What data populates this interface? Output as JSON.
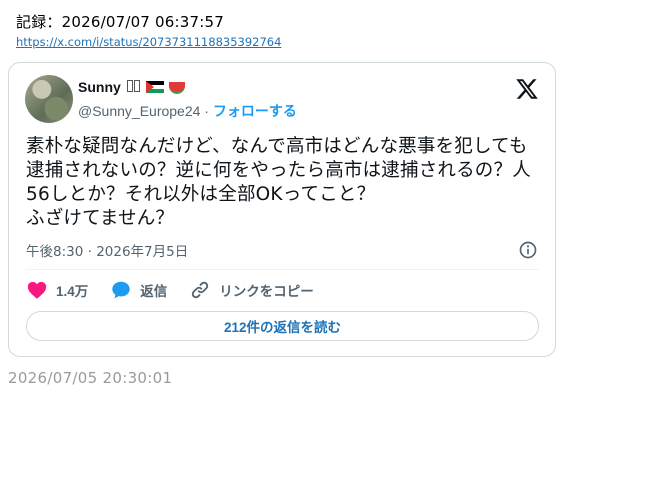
{
  "record": {
    "label": "記録：2026/07/07 06:37:57"
  },
  "source_link": {
    "url_text": "https://x.com/i/status/2073731118835392764"
  },
  "tweet": {
    "author": {
      "name": "Sunny",
      "name_symbols": "",
      "handle": "@Sunny_Europe24",
      "separator": " · ",
      "follow_label": "フォローする"
    },
    "text": "素朴な疑問なんだけど、なんで高市はどんな悪事を犯しても逮捕されないの？逆に何をやったら高市は逮捕されるの？人56しとか？それ以外は全部OKってこと？\nふざけてません？",
    "timestamp": "午後8:30 · 2026年7月5日",
    "actions": {
      "likes": "1.4万",
      "reply_label": "返信",
      "copy_link_label": "リンクをコピー"
    },
    "read_replies_label": "212件の返信を読む"
  },
  "posted_at": "2026/07/05 20:30:01",
  "colors": {
    "accent": "#1d9bf0",
    "like": "#f91880",
    "reply": "#1d9bf0",
    "border": "#cfd9de",
    "muted": "#536471"
  },
  "icons": [
    "x-logo-icon",
    "info-icon",
    "heart-icon",
    "speech-bubble-icon",
    "link-icon"
  ]
}
